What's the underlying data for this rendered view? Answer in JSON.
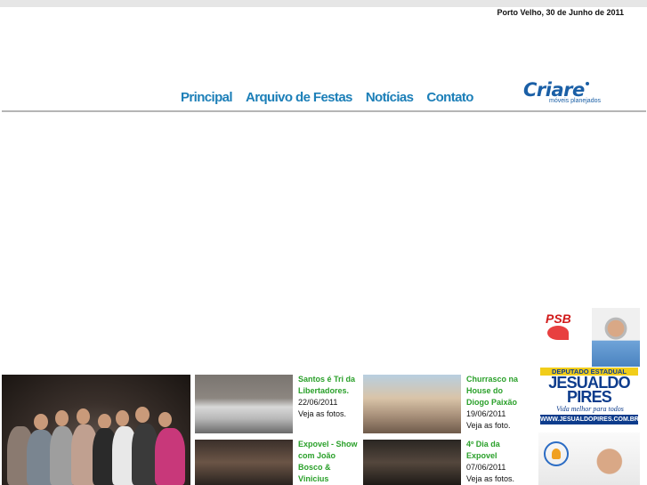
{
  "header": {
    "date": "Porto Velho, 30 de Junho de 2011"
  },
  "nav": {
    "items": [
      "Principal",
      "Arquivo de Festas",
      "Notícias",
      "Contato"
    ]
  },
  "brand": {
    "name": "Criare",
    "tagline": "móveis planejados"
  },
  "news": [
    {
      "title": "Santos é Tri da Libertadores.",
      "date": "22/06/2011",
      "link": "Veja as fotos."
    },
    {
      "title": "Churrasco na House do Diogo Paixão",
      "date": "19/06/2011",
      "link": "Veja as foto."
    },
    {
      "title": "Expovel - Show com João Bosco & Vinicius",
      "date": "",
      "link": ""
    },
    {
      "title": "4º Dia da Expovel",
      "date": "07/06/2011",
      "link": "Veja as fotos."
    }
  ],
  "ads": {
    "party": "PSB",
    "role": "DEPUTADO ESTADUAL",
    "candidate": "JESUALDO PIRES",
    "motto": "Vida melhor para todos",
    "site": "WWW.JESUALDOPIRES.COM.BR"
  },
  "colors": {
    "nav": "#1c7fb8",
    "news_title": "#2aa02a",
    "brand": "#1a5fa6"
  }
}
